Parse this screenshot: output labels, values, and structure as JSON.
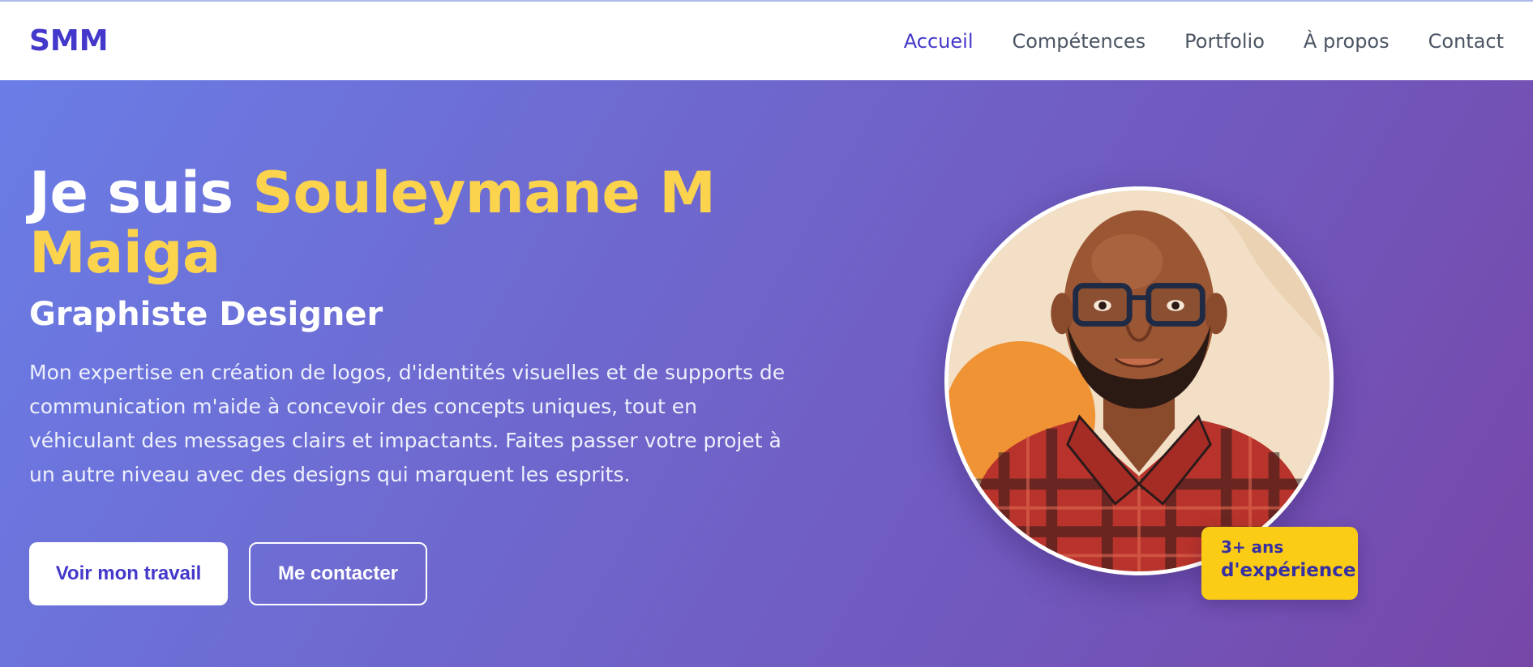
{
  "brand": {
    "logo": "SMM"
  },
  "nav": {
    "items": [
      {
        "label": "Accueil",
        "active": true
      },
      {
        "label": "Compétences",
        "active": false
      },
      {
        "label": "Portfolio",
        "active": false
      },
      {
        "label": "À propos",
        "active": false
      },
      {
        "label": "Contact",
        "active": false
      }
    ]
  },
  "hero": {
    "title_prefix": "Je suis ",
    "name": "Souleymane M Maiga",
    "subtitle": "Graphiste Designer",
    "description": "Mon expertise en création de logos, d'identités visuelles et de supports de communication m'aide à concevoir des concepts uniques, tout en véhiculant des messages clairs et impactants. Faites passer votre projet à un autre niveau avec des designs qui marquent les esprits.",
    "primary_button": "Voir mon travail",
    "secondary_button": "Me contacter",
    "badge_line1": "3+ ans",
    "badge_line2": "d'expérience",
    "avatar_icon": "profile-portrait-illustration"
  },
  "colors": {
    "accent": "#4338ca",
    "highlight": "#fcd34d",
    "badge": "#facc15",
    "gradient_start": "#6a7de6",
    "gradient_end": "#7747a8"
  }
}
